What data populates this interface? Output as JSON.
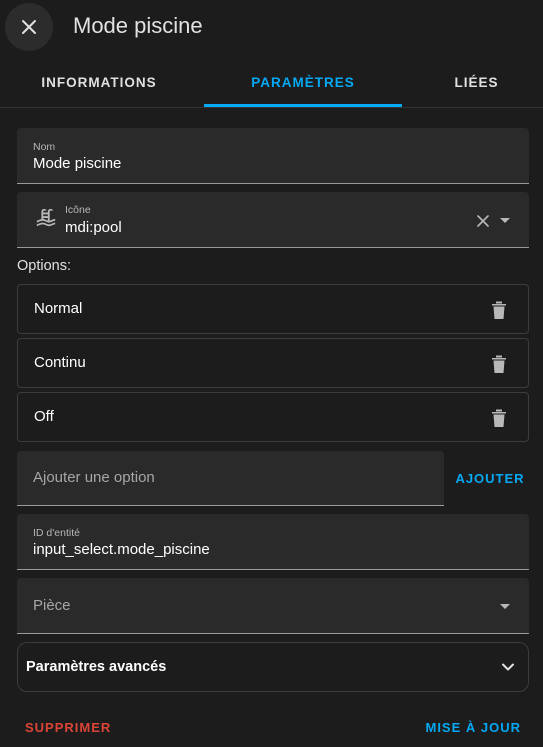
{
  "header": {
    "title": "Mode piscine",
    "close_icon": "close-icon"
  },
  "tabs": [
    {
      "label": "INFORMATIONS",
      "active": false
    },
    {
      "label": "PARAMÈTRES",
      "active": true
    },
    {
      "label": "LIÉES",
      "active": false
    }
  ],
  "name_field": {
    "label": "Nom",
    "value": "Mode piscine"
  },
  "icon_field": {
    "label": "Icône",
    "value": "mdi:pool",
    "icon": "pool-icon"
  },
  "options": {
    "label": "Options:",
    "items": [
      {
        "label": "Normal"
      },
      {
        "label": "Continu"
      },
      {
        "label": "Off"
      }
    ]
  },
  "add_option": {
    "placeholder": "Ajouter une option",
    "button_label": "AJOUTER"
  },
  "entity_id_field": {
    "label": "ID d'entité",
    "value": "input_select.mode_piscine"
  },
  "area_field": {
    "placeholder": "Pièce"
  },
  "advanced": {
    "label": "Paramètres avancés"
  },
  "footer": {
    "delete_label": "SUPPRIMER",
    "update_label": "MISE À JOUR"
  },
  "colors": {
    "accent": "#03a9f4",
    "danger": "#db4437",
    "background": "#1c1c1c",
    "field_background": "#2a2a2a"
  }
}
